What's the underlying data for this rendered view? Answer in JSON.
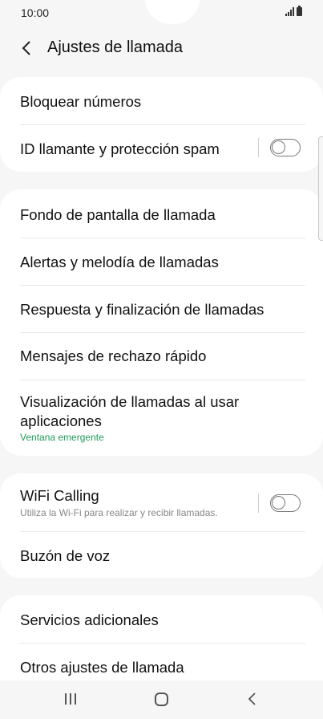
{
  "status_bar": {
    "time": "10:00"
  },
  "header": {
    "title": "Ajustes de llamada"
  },
  "group1": {
    "block_numbers": "Bloquear números",
    "caller_id": "ID llamante y protección spam",
    "caller_id_enabled": false
  },
  "group2": {
    "wallpaper": "Fondo de pantalla de llamada",
    "alerts": "Alertas y melodía de llamadas",
    "answer_end": "Respuesta y finalización de llamadas",
    "quick_decline": "Mensajes de rechazo rápido",
    "display_while_apps": "Visualización de llamadas al usar aplicaciones",
    "display_while_apps_value": "Ventana emergente"
  },
  "group3": {
    "wifi_calling": "WiFi Calling",
    "wifi_calling_desc": "Utiliza la Wi-Fi para realizar y recibir llamadas.",
    "wifi_calling_enabled": false,
    "voicemail": "Buzón de voz"
  },
  "group4": {
    "additional_services": "Servicios adicionales",
    "other_settings": "Otros ajustes de llamada"
  },
  "colors": {
    "accent_green": "#1e9b5a",
    "background": "#f6f6f6",
    "card": "#ffffff"
  }
}
